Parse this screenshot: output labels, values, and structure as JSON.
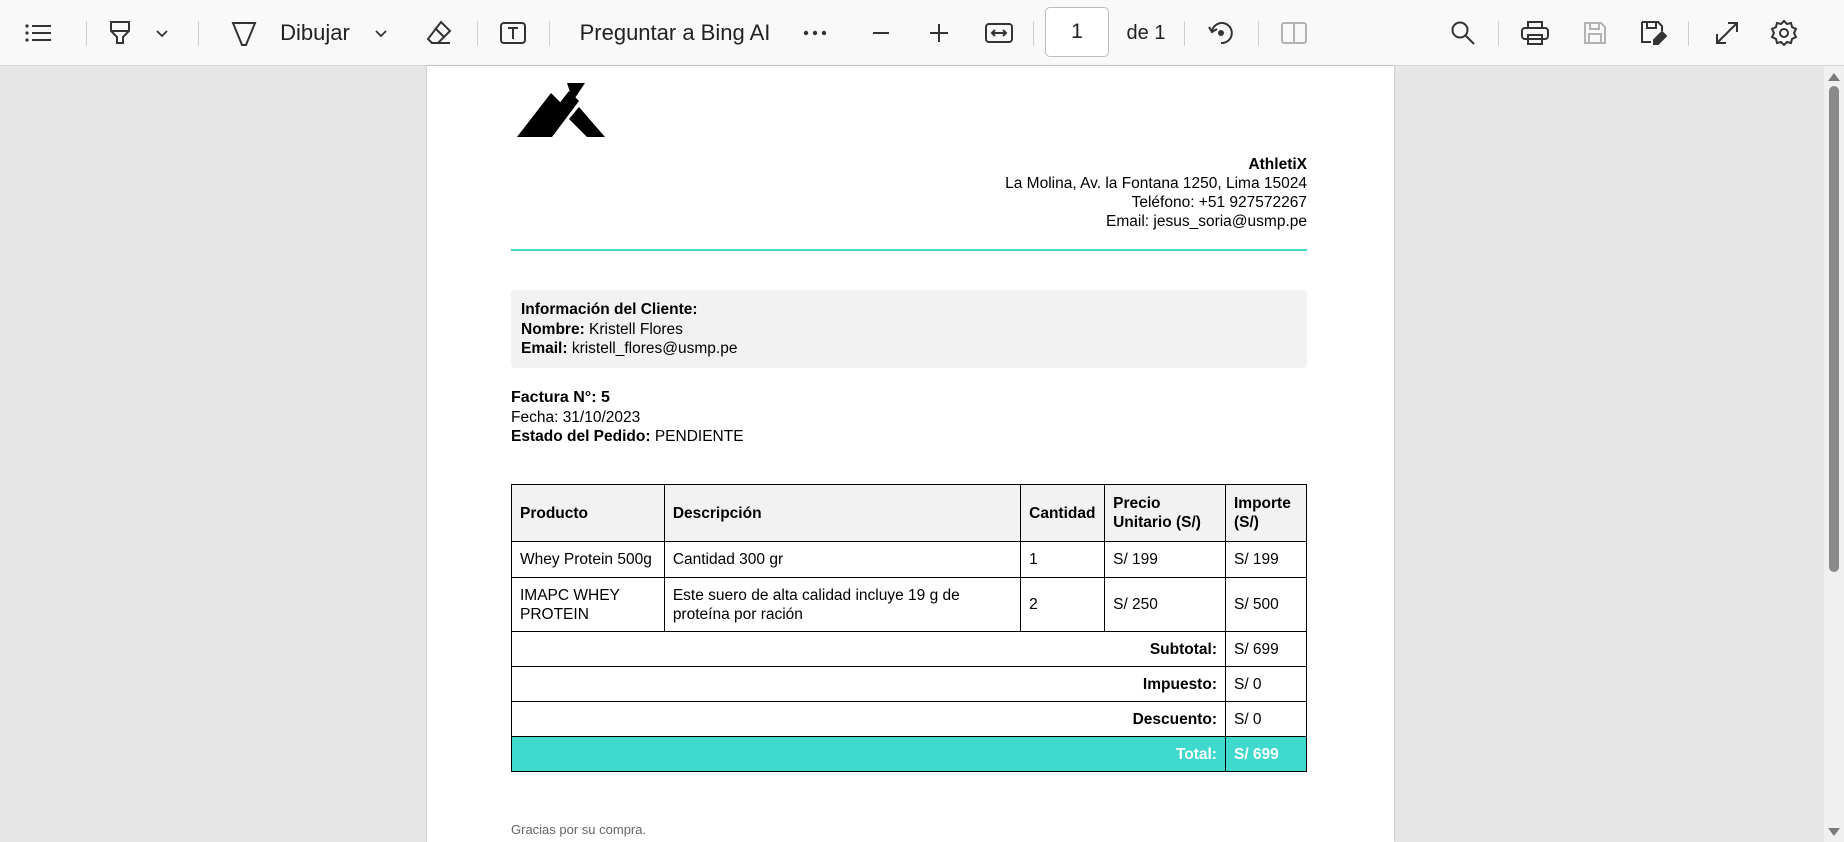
{
  "toolbar": {
    "draw_label": "Dibujar",
    "bing_label": "Preguntar a Bing AI",
    "page_value": "1",
    "page_total": "de 1",
    "icons": [
      "list-icon",
      "highlight-icon",
      "chevron-down-icon",
      "draw-icon",
      "chevron-down-icon",
      "eraser-icon",
      "text-icon",
      "more-icon",
      "zoom-out-icon",
      "zoom-in-icon",
      "fit-width-icon",
      "rotate-icon",
      "two-page-icon",
      "search-icon",
      "print-icon",
      "save-icon",
      "save-as-icon",
      "fullscreen-icon",
      "settings-icon"
    ]
  },
  "document": {
    "company": {
      "name": "AthletiX",
      "address": "La Molina, Av. la Fontana 1250, Lima 15024",
      "phone": "Teléfono: +51 927572267",
      "email": "Email: jesus_soria@usmp.pe"
    },
    "client": {
      "heading": "Información del Cliente:",
      "name_label": "Nombre:",
      "name": "Kristell Flores",
      "email_label": "Email:",
      "email": "kristell_flores@usmp.pe"
    },
    "invoice": {
      "number": "Factura N°: 5",
      "date": "Fecha: 31/10/2023",
      "status_label": "Estado del Pedido:",
      "status": "PENDIENTE"
    },
    "table": {
      "headers": [
        "Producto",
        "Descripción",
        "Cantidad",
        "Precio Unitario (S/)",
        "Importe (S/)"
      ],
      "rows": [
        [
          "Whey Protein 500g",
          "Cantidad 300 gr",
          "1",
          "S/ 199",
          "S/ 199"
        ],
        [
          "IMAPC WHEY PROTEIN",
          "Este suero de alta calidad incluye 19 g de proteína por ración",
          "2",
          "S/ 250",
          "S/ 500"
        ]
      ],
      "subtotal_label": "Subtotal:",
      "subtotal": "S/ 699",
      "tax_label": "Impuesto:",
      "tax": "S/ 0",
      "discount_label": "Descuento:",
      "discount": "S/ 0",
      "total_label": "Total:",
      "total": "S/ 699"
    },
    "footer": "Gracias por su compra."
  },
  "colors": {
    "accent": "#3fd9cd",
    "toolbar_bg": "#f9f9f9",
    "canvas_bg": "#e6e6e6"
  }
}
